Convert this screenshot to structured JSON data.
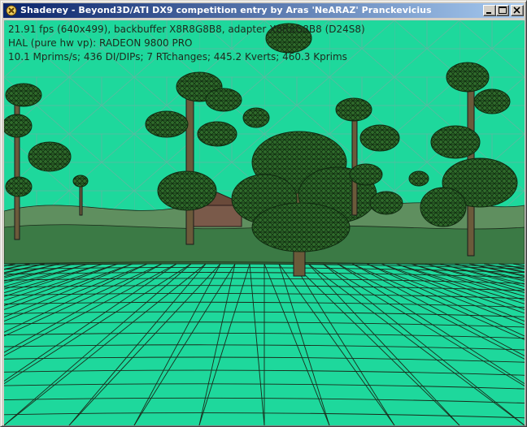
{
  "window": {
    "title": "Shaderey - Beyond3D/ATI DX9 competition entry by Aras 'NeARAZ' Pranckevicius",
    "controls": [
      "minimize",
      "maximize",
      "close"
    ]
  },
  "icons": {
    "app": "shaderey-app-icon",
    "minimize": "minimize-icon",
    "maximize": "maximize-icon",
    "close": "close-icon"
  },
  "stats": {
    "line1": "21.91 fps (640x499), backbuffer X8R8G8B8, adapter X8R8G8B8 (D24S8)",
    "line2": "HAL (pure hw vp): RADEON 9800 PRO",
    "line3": "10.1 Mprims/s; 436 DI/DIPs; 7 RTchanges; 445.2 Kverts; 460.3 Kprims"
  },
  "colors": {
    "wire_fill": "#1ed89c",
    "wire_line": "#1a2a1a",
    "foliage": "#2f6b2b",
    "trunk": "#6b5a3a",
    "title_active_start": "#0a246a",
    "title_active_end": "#a6caf0"
  }
}
